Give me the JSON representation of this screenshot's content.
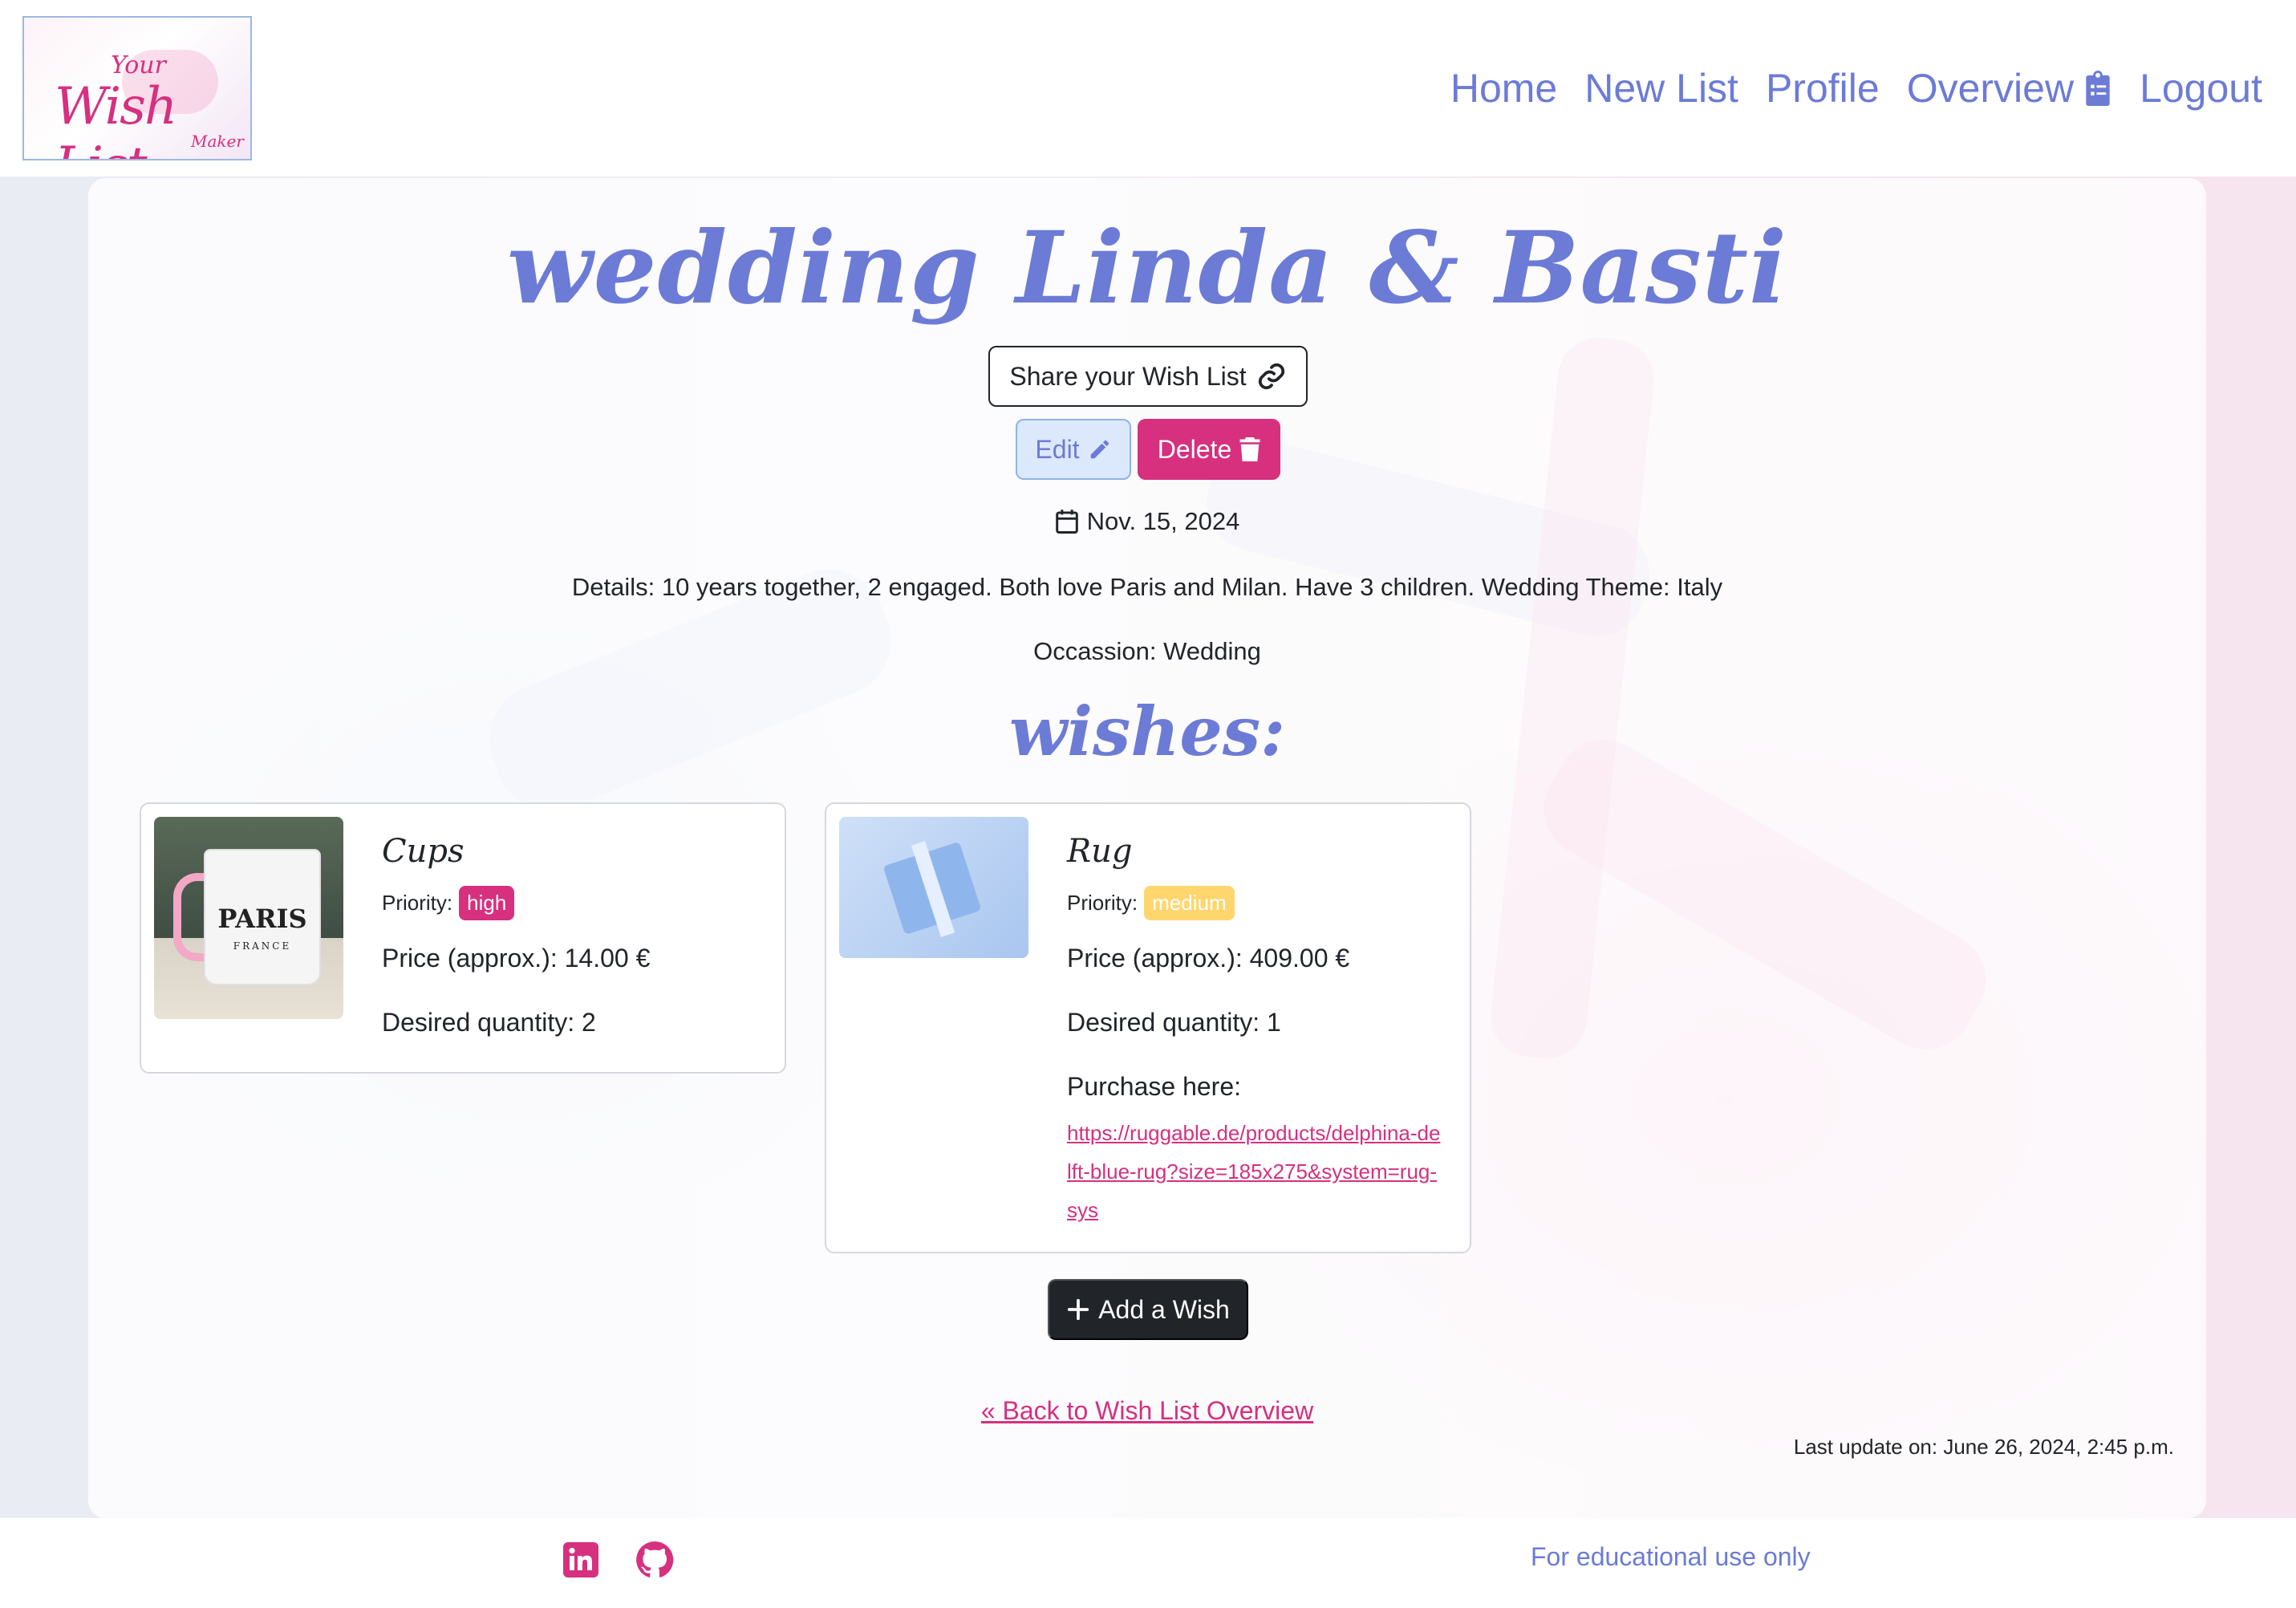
{
  "nav": {
    "logo_text": {
      "line1": "Your",
      "line2": "Wish List",
      "line3": "Maker"
    },
    "links": [
      {
        "label": "Home"
      },
      {
        "label": "New List"
      },
      {
        "label": "Profile"
      },
      {
        "label": "Overview",
        "icon": "clipboard-list-icon"
      },
      {
        "label": "Logout"
      }
    ]
  },
  "list": {
    "title": "wedding Linda & Basti",
    "share_label": "Share your Wish List",
    "edit_label": "Edit",
    "delete_label": "Delete",
    "date": "Nov. 15, 2024",
    "details": "Details: 10 years together, 2 engaged. Both love Paris and Milan. Have 3 children. Wedding Theme: Italy",
    "occasion": "Occassion: Wedding"
  },
  "wishes": {
    "title": "wishes:",
    "items": [
      {
        "name": "Cups",
        "priority_label": "Priority:",
        "priority": "high",
        "price": "Price (approx.): 14.00 €",
        "quantity": "Desired quantity: 2",
        "image_text": "PARIS",
        "image_subtext": "FRANCE"
      },
      {
        "name": "Rug",
        "priority_label": "Priority:",
        "priority": "medium",
        "price": "Price (approx.): 409.00 €",
        "quantity": "Desired quantity: 1",
        "purchase_label": "Purchase here:",
        "purchase_url": "https://ruggable.de/products/delphina-delft-blue-rug?size=185x275&system=rug-sys"
      }
    ]
  },
  "actions": {
    "add_wish_label": "Add a Wish",
    "back_link": "« Back to Wish List Overview",
    "last_update": "Last update on: June 26, 2024, 2:45 p.m."
  },
  "footer": {
    "text": "For educational use only",
    "icons": [
      "linkedin-icon",
      "github-icon"
    ]
  },
  "colors": {
    "accent": "#6c7bd6",
    "brand_pink": "#d6307f",
    "medium_badge": "#ffd66e",
    "dark_button": "#212529"
  }
}
